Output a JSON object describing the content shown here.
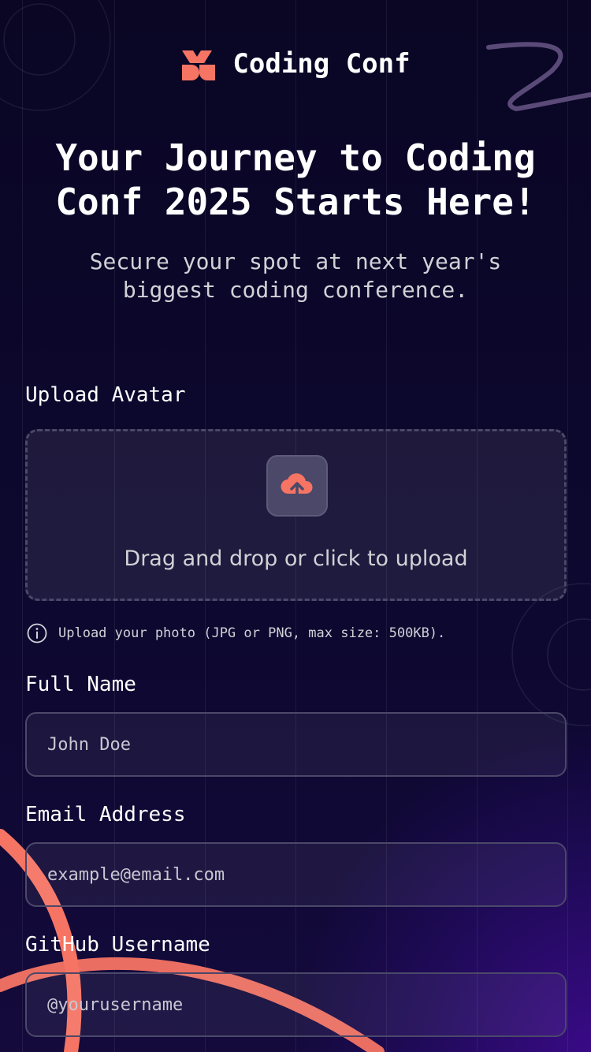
{
  "brand": {
    "name": "Coding Conf",
    "logo_icon": "coding-conf-logo-icon",
    "accent": "#f57463"
  },
  "hero": {
    "title": "Your Journey to Coding Conf 2025 Starts Here!",
    "subtitle": "Secure your spot at next year's biggest coding conference."
  },
  "form": {
    "avatar": {
      "label": "Upload Avatar",
      "dropzone_text": "Drag and drop or click to upload",
      "icon": "upload-cloud-icon",
      "hint": "Upload your photo (JPG or PNG, max size: 500KB).",
      "hint_icon": "info-icon"
    },
    "full_name": {
      "label": "Full Name",
      "placeholder": "John Doe"
    },
    "email": {
      "label": "Email Address",
      "placeholder": "example@email.com"
    },
    "github": {
      "label": "GitHub Username",
      "placeholder": "@yourusername"
    }
  },
  "colors": {
    "background": "#0b0726",
    "accent": "#f57463",
    "neutral_500": "#4b4869",
    "neutral_300": "#d2d1d6"
  }
}
